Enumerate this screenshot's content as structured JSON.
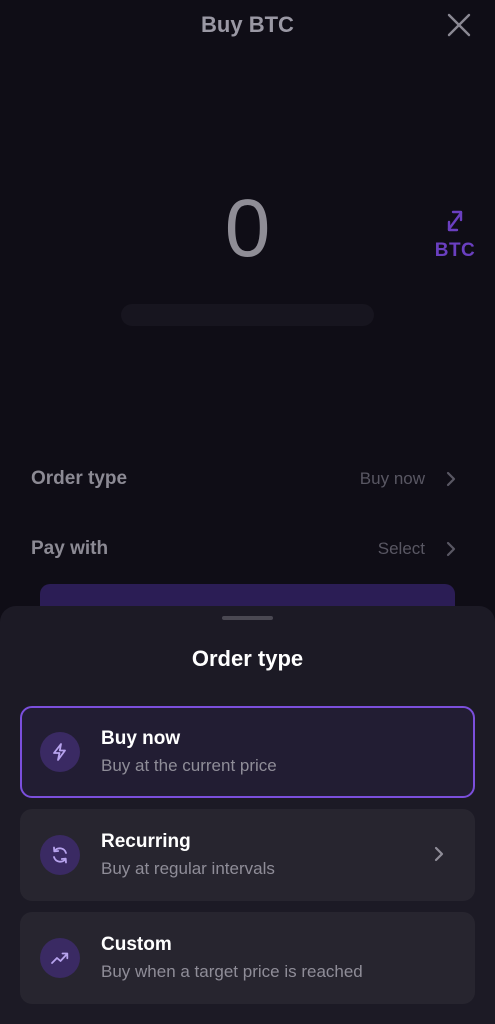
{
  "header": {
    "title": "Buy BTC"
  },
  "amount": {
    "value": "0",
    "switch_currency": "BTC"
  },
  "rows": {
    "order_type": {
      "label": "Order type",
      "value": "Buy now"
    },
    "pay_with": {
      "label": "Pay with",
      "value": "Select"
    }
  },
  "sheet": {
    "title": "Order type",
    "options": [
      {
        "title": "Buy now",
        "subtitle": "Buy at the current price",
        "icon": "lightning-icon",
        "selected": true
      },
      {
        "title": "Recurring",
        "subtitle": "Buy at regular intervals",
        "icon": "recurring-icon",
        "selected": false
      },
      {
        "title": "Custom",
        "subtitle": "Buy when a target price is reached",
        "icon": "trend-up-icon",
        "selected": false
      }
    ]
  },
  "colors": {
    "accent": "#7b4fdc",
    "background": "#0f0d16",
    "sheet": "#1c1a25",
    "card": "#27252f"
  }
}
